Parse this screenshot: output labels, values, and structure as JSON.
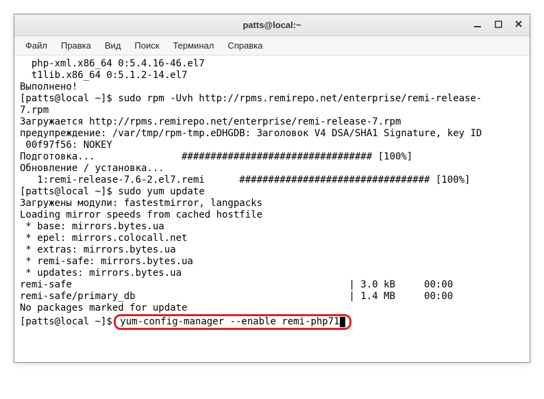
{
  "window": {
    "title": "patts@local:~"
  },
  "menu": {
    "file": "Файл",
    "edit": "Правка",
    "view": "Вид",
    "search": "Поиск",
    "terminal": "Терминал",
    "help": "Справка"
  },
  "terminal_lines": [
    "  php-xml.x86_64 0:5.4.16-46.el7",
    "  t1lib.x86_64 0:5.1.2-14.el7",
    "",
    "Выполнено!",
    "[patts@local ~]$ sudo rpm -Uvh http://rpms.remirepo.net/enterprise/remi-release-",
    "7.rpm",
    "Загружается http://rpms.remirepo.net/enterprise/remi-release-7.rpm",
    "предупреждение: /var/tmp/rpm-tmp.eDHGDB: Заголовок V4 DSA/SHA1 Signature, key ID",
    " 00f97f56: NOKEY",
    "Подготовка...               ################################# [100%]",
    "Обновление / установка...",
    "   1:remi-release-7.6-2.el7.remi      ################################# [100%]",
    "[patts@local ~]$ sudo yum update",
    "Загружены модули: fastestmirror, langpacks",
    "Loading mirror speeds from cached hostfile",
    " * base: mirrors.bytes.ua",
    " * epel: mirrors.colocall.net",
    " * extras: mirrors.bytes.ua",
    " * remi-safe: mirrors.bytes.ua",
    " * updates: mirrors.bytes.ua",
    "remi-safe                                                | 3.0 kB     00:00",
    "remi-safe/primary_db                                     | 1.4 MB     00:00",
    "No packages marked for update"
  ],
  "prompt": "[patts@local ~]$ ",
  "highlighted_command": "yum-config-manager --enable remi-php71"
}
